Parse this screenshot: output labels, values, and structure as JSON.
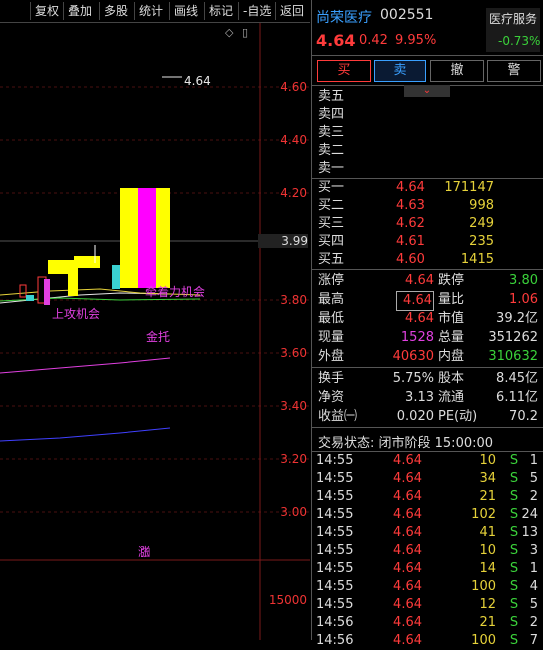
{
  "toolbar": {
    "buttons": [
      "复权",
      "叠加",
      "多股",
      "统计",
      "画线",
      "标记",
      "-自选",
      "返回"
    ]
  },
  "chart": {
    "price_ticks": [
      "4.60",
      "4.40",
      "4.20",
      "3.99",
      "3.80",
      "3.60",
      "3.40",
      "3.20",
      "3.00"
    ],
    "volume_tick": "15000",
    "annotation_high": "4.64",
    "annotation_texts": [
      "牵着力机会",
      "上攻机会",
      "金托"
    ],
    "zhang_mark": "涨",
    "colors": {
      "up": "#ff3b3b",
      "down": "#3ad13a",
      "ma1": "#e6e6e6",
      "ma2": "#e6d23a",
      "ma3": "#e040e0",
      "ma4": "#4040ff"
    }
  },
  "header": {
    "name": "尚荣医疗",
    "code": "002551",
    "price": "4.64",
    "change": "0.42",
    "change_pct": "9.95%",
    "sector": "医疗服务",
    "sector_pct": "-0.73%"
  },
  "actions": [
    "买",
    "卖",
    "撤",
    "警"
  ],
  "sell_book": [
    {
      "label": "卖五",
      "price": "",
      "vol": ""
    },
    {
      "label": "卖四",
      "price": "",
      "vol": ""
    },
    {
      "label": "卖三",
      "price": "",
      "vol": ""
    },
    {
      "label": "卖二",
      "price": "",
      "vol": ""
    },
    {
      "label": "卖一",
      "price": "",
      "vol": ""
    }
  ],
  "buy_book": [
    {
      "label": "买一",
      "price": "4.64",
      "vol": "171147"
    },
    {
      "label": "买二",
      "price": "4.63",
      "vol": "998"
    },
    {
      "label": "买三",
      "price": "4.62",
      "vol": "249"
    },
    {
      "label": "买四",
      "price": "4.61",
      "vol": "235"
    },
    {
      "label": "买五",
      "price": "4.60",
      "vol": "1415"
    }
  ],
  "quote_rows": [
    {
      "l1": "涨停",
      "v1": "4.64",
      "l2": "跌停",
      "v2": "3.80"
    },
    {
      "l1": "最高",
      "v1": "4.64",
      "l2": "量比",
      "v2": "1.06"
    },
    {
      "l1": "最低",
      "v1": "4.64",
      "l2": "市值",
      "v2": "39.2亿"
    },
    {
      "l1": "现量",
      "v1": "1528",
      "l2": "总量",
      "v2": "351262"
    },
    {
      "l1": "外盘",
      "v1": "40630",
      "l2": "内盘",
      "v2": "310632"
    }
  ],
  "fin_rows": [
    {
      "l1": "换手",
      "v1": "5.75%",
      "l2": "股本",
      "v2": "8.45亿"
    },
    {
      "l1": "净资",
      "v1": "3.13",
      "l2": "流通",
      "v2": "6.11亿"
    },
    {
      "l1": "收益㈠",
      "v1": "0.020",
      "l2": "PE(动)",
      "v2": "70.2"
    }
  ],
  "status": "交易状态: 闭市阶段 15:00:00",
  "ticks": [
    {
      "time": "14:55",
      "price": "4.64",
      "vol": "10",
      "side": "S",
      "n": "1"
    },
    {
      "time": "14:55",
      "price": "4.64",
      "vol": "34",
      "side": "S",
      "n": "5"
    },
    {
      "time": "14:55",
      "price": "4.64",
      "vol": "21",
      "side": "S",
      "n": "2"
    },
    {
      "time": "14:55",
      "price": "4.64",
      "vol": "102",
      "side": "S",
      "n": "24"
    },
    {
      "time": "14:55",
      "price": "4.64",
      "vol": "41",
      "side": "S",
      "n": "13"
    },
    {
      "time": "14:55",
      "price": "4.64",
      "vol": "10",
      "side": "S",
      "n": "3"
    },
    {
      "time": "14:55",
      "price": "4.64",
      "vol": "14",
      "side": "S",
      "n": "1"
    },
    {
      "time": "14:55",
      "price": "4.64",
      "vol": "100",
      "side": "S",
      "n": "4"
    },
    {
      "time": "14:55",
      "price": "4.64",
      "vol": "12",
      "side": "S",
      "n": "5"
    },
    {
      "time": "14:56",
      "price": "4.64",
      "vol": "21",
      "side": "S",
      "n": "2"
    },
    {
      "time": "14:56",
      "price": "4.64",
      "vol": "100",
      "side": "S",
      "n": "7"
    }
  ]
}
